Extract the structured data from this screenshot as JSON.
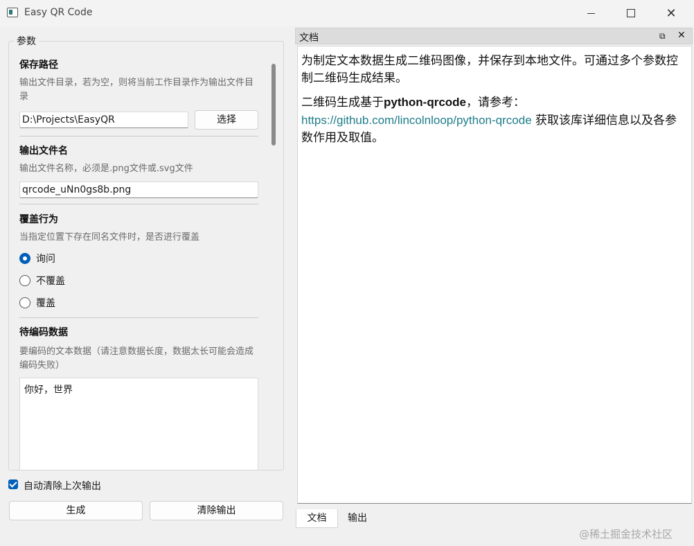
{
  "window": {
    "title": "Easy QR Code"
  },
  "params": {
    "group_title": "参数",
    "save_path": {
      "title": "保存路径",
      "desc": "输出文件目录，若为空，则将当前工作目录作为输出文件目录",
      "value": "D:\\Projects\\EasyQR",
      "choose_label": "选择"
    },
    "filename": {
      "title": "输出文件名",
      "desc": "输出文件名称，必须是.png文件或.svg文件",
      "value": "qrcode_uNn0gs8b.png"
    },
    "overwrite": {
      "title": "覆盖行为",
      "desc": "当指定位置下存在同名文件时，是否进行覆盖",
      "options": [
        "询问",
        "不覆盖",
        "覆盖"
      ],
      "selected": "询问"
    },
    "data": {
      "title": "待编码数据",
      "desc": "要编码的文本数据（请注意数据长度，数据太长可能会造成编码失败）",
      "value": "你好，世界"
    }
  },
  "auto_clear": {
    "label": "自动清除上次输出",
    "checked": true
  },
  "actions": {
    "generate_label": "生成",
    "clear_label": "清除输出"
  },
  "dock": {
    "title": "文档",
    "doc_para1": "为制定文本数据生成二维码图像，并保存到本地文件。可通过多个参数控制二维码生成结果。",
    "doc_para2_prefix": "二维码生成基于",
    "doc_para2_bold": "python-qrcode",
    "doc_para2_mid": "，请参考：",
    "doc_link": "https://github.com/lincolnloop/python-qrcode",
    "doc_para2_suffix": " 获取该库详细信息以及各参数作用及取值。",
    "tabs": [
      "文档",
      "输出"
    ],
    "active_tab": "文档"
  },
  "watermark": "@稀土掘金技术社区",
  "colors": {
    "accent": "#005fb8",
    "link": "#1e7d8a"
  }
}
